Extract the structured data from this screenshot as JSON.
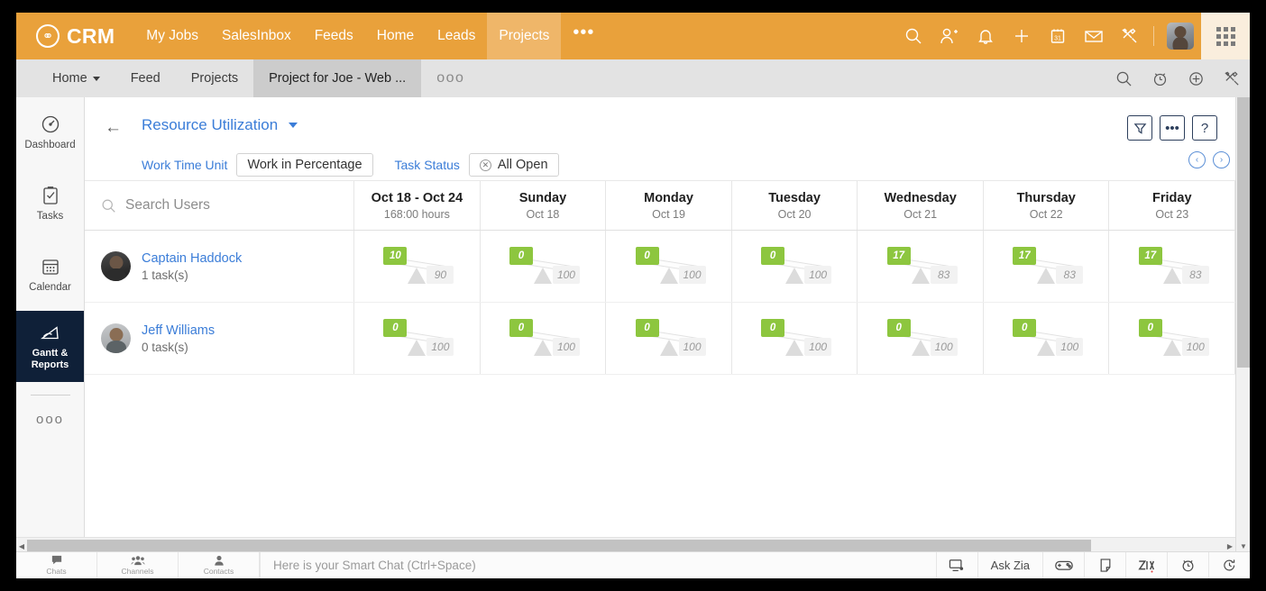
{
  "topbar": {
    "brand": "CRM",
    "brand_icon": "crm-logo-icon",
    "nav": [
      {
        "label": "My Jobs",
        "active": false
      },
      {
        "label": "SalesInbox",
        "active": false
      },
      {
        "label": "Feeds",
        "active": false
      },
      {
        "label": "Home",
        "active": false
      },
      {
        "label": "Leads",
        "active": false
      },
      {
        "label": "Projects",
        "active": true
      }
    ],
    "more": "•••",
    "icons": [
      "search-icon",
      "add-user-icon",
      "bell-icon",
      "plus-icon",
      "calendar-icon",
      "mail-icon",
      "tools-icon"
    ],
    "calendar_day": "31",
    "accent": "#e9a13b",
    "accent_active": "#efb669"
  },
  "subbar": {
    "items": [
      {
        "label": "Home",
        "active": false,
        "caret": true
      },
      {
        "label": "Feed",
        "active": false,
        "caret": false
      },
      {
        "label": "Projects",
        "active": false,
        "caret": false
      },
      {
        "label": "Project for Joe - Web ...",
        "active": true,
        "caret": false
      }
    ],
    "more": "ooo",
    "icons": [
      "search-icon",
      "alarm-clock-icon",
      "plus-circle-icon",
      "tools-icon"
    ]
  },
  "sidebar": {
    "items": [
      {
        "label": "Dashboard",
        "icon": "gauge-icon",
        "active": false
      },
      {
        "label": "Tasks",
        "icon": "clipboard-check-icon",
        "active": false
      },
      {
        "label": "Calendar",
        "icon": "calendar-icon",
        "active": false
      },
      {
        "label": "Gantt & Reports",
        "icon": "chart-area-icon",
        "active": true
      }
    ],
    "more": "ooo",
    "active_bg": "#0f2038"
  },
  "report": {
    "back_icon": "back-arrow-icon",
    "title": "Resource Utilization",
    "filters": [
      {
        "label": "Work Time Unit",
        "value": "Work in Percentage",
        "removable": false
      },
      {
        "label": "Task Status",
        "value": "All Open",
        "removable": true
      }
    ],
    "actions": [
      {
        "icon": "filter-icon",
        "glyph": ""
      },
      {
        "icon": "more-options-icon",
        "glyph": "•••"
      },
      {
        "icon": "help-icon",
        "glyph": "?"
      }
    ],
    "pager": [
      {
        "icon": "chevron-left-icon",
        "glyph": "‹"
      },
      {
        "icon": "chevron-right-icon",
        "glyph": "›"
      }
    ]
  },
  "grid": {
    "search_placeholder": "Search Users",
    "columns": [
      {
        "title": "Oct 18 - Oct 24",
        "sub": "168:00 hours"
      },
      {
        "title": "Sunday",
        "sub": "Oct 18"
      },
      {
        "title": "Monday",
        "sub": "Oct 19"
      },
      {
        "title": "Tuesday",
        "sub": "Oct 20"
      },
      {
        "title": "Wednesday",
        "sub": "Oct 21"
      },
      {
        "title": "Thursday",
        "sub": "Oct 22"
      },
      {
        "title": "Friday",
        "sub": "Oct 23"
      }
    ],
    "rows": [
      {
        "name": "Captain Haddock",
        "tasks": "1 task(s)",
        "avatar": "avatar-captain-haddock",
        "cells": [
          {
            "allocated": "10",
            "available": "90"
          },
          {
            "allocated": "0",
            "available": "100"
          },
          {
            "allocated": "0",
            "available": "100"
          },
          {
            "allocated": "0",
            "available": "100"
          },
          {
            "allocated": "17",
            "available": "83"
          },
          {
            "allocated": "17",
            "available": "83"
          },
          {
            "allocated": "17",
            "available": "83"
          }
        ]
      },
      {
        "name": "Jeff Williams",
        "tasks": "0 task(s)",
        "avatar": "avatar-jeff-williams",
        "cells": [
          {
            "allocated": "0",
            "available": "100"
          },
          {
            "allocated": "0",
            "available": "100"
          },
          {
            "allocated": "0",
            "available": "100"
          },
          {
            "allocated": "0",
            "available": "100"
          },
          {
            "allocated": "0",
            "available": "100"
          },
          {
            "allocated": "0",
            "available": "100"
          },
          {
            "allocated": "0",
            "available": "100"
          }
        ]
      }
    ],
    "badge_green": "#8dc63f",
    "badge_grey": "#f2f2f2"
  },
  "chart_data": {
    "type": "bar",
    "title": "Resource Utilization",
    "categories": [
      "Oct 18 - Oct 24",
      "Sunday Oct 18",
      "Monday Oct 19",
      "Tuesday Oct 20",
      "Wednesday Oct 21",
      "Thursday Oct 22",
      "Friday Oct 23"
    ],
    "series": [
      {
        "name": "Captain Haddock - allocated %",
        "values": [
          10,
          0,
          0,
          0,
          17,
          17,
          17
        ]
      },
      {
        "name": "Captain Haddock - available %",
        "values": [
          90,
          100,
          100,
          100,
          83,
          83,
          83
        ]
      },
      {
        "name": "Jeff Williams - allocated %",
        "values": [
          0,
          0,
          0,
          0,
          0,
          0,
          0
        ]
      },
      {
        "name": "Jeff Williams - available %",
        "values": [
          100,
          100,
          100,
          100,
          100,
          100,
          100
        ]
      }
    ],
    "xlabel": "",
    "ylabel": "Work in Percentage",
    "ylim": [
      0,
      100
    ]
  },
  "chatbar": {
    "items": [
      {
        "label": "Chats",
        "icon": "chat-bubble-icon"
      },
      {
        "label": "Channels",
        "icon": "people-group-icon"
      },
      {
        "label": "Contacts",
        "icon": "person-icon"
      }
    ],
    "placeholder": "Here is your Smart Chat (Ctrl+Space)",
    "ask_zia": "Ask Zia",
    "right_icons": [
      "screen-share-icon",
      "game-controller-icon",
      "note-icon",
      "zia-icon",
      "alarm-clock-icon",
      "history-icon"
    ]
  }
}
